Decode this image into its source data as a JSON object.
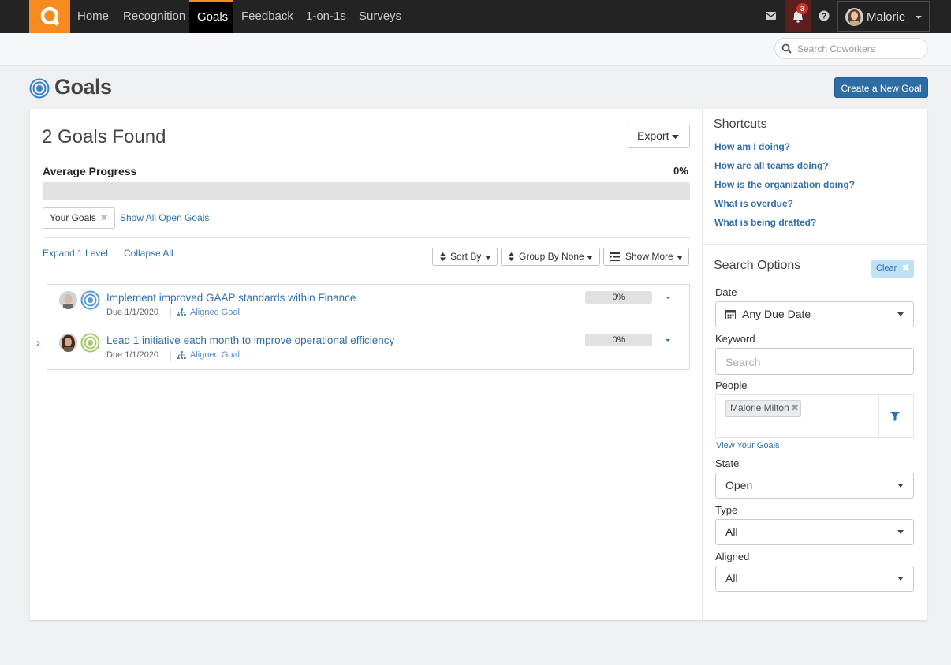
{
  "nav": {
    "items": [
      {
        "label": "Home"
      },
      {
        "label": "Recognition"
      },
      {
        "label": "Goals",
        "active": true
      },
      {
        "label": "Feedback"
      },
      {
        "label": "1-on-1s"
      },
      {
        "label": "Surveys"
      }
    ],
    "notification_count": "3",
    "user_name": "Malorie",
    "icons": [
      "logo-icon",
      "mail-icon",
      "bell-icon",
      "help-icon",
      "avatar",
      "caret-down-icon"
    ]
  },
  "search": {
    "placeholder": "Search Coworkers"
  },
  "page": {
    "title": "Goals",
    "create_button": "Create a New Goal"
  },
  "main": {
    "goals_found": "2 Goals Found",
    "export_label": "Export",
    "avg_progress_label": "Average Progress",
    "avg_progress_value": "0%",
    "avg_progress_fraction": 0,
    "filter_chip": "Your Goals",
    "filter_chip_remove": "✖",
    "show_all_link": "Show All Open Goals",
    "expand_link": "Expand 1 Level",
    "collapse_link": "Collapse All",
    "sort_label": "Sort By",
    "group_label": "Group By None",
    "showmore_label": "Show More"
  },
  "goals": [
    {
      "title": "Implement improved GAAP standards within Finance",
      "due": "Due 1/1/2020",
      "aligned": "Aligned Goal",
      "progress_text": "0%",
      "progress_fraction": 0,
      "status_color": "#5b9bd5"
    },
    {
      "title": "Lead 1 initiative each month to improve operational efficiency",
      "due": "Due 1/1/2020",
      "aligned": "Aligned Goal",
      "progress_text": "0%",
      "progress_fraction": 0,
      "status_color": "#a6c865"
    }
  ],
  "expand_chevron": "›",
  "sidebar": {
    "shortcuts_title": "Shortcuts",
    "shortcuts": [
      {
        "label": "How am I doing?"
      },
      {
        "label": "How are all teams doing?"
      },
      {
        "label": "How is the organization doing?"
      },
      {
        "label": "What is overdue?"
      },
      {
        "label": "What is being drafted?"
      }
    ],
    "search_options_title": "Search Options",
    "clear_label": "Clear",
    "clear_remove": "✖",
    "date_label": "Date",
    "date_value": "Any Due Date",
    "keyword_label": "Keyword",
    "keyword_placeholder": "Search",
    "people_label": "People",
    "people_chip": "Malorie Milton",
    "people_chip_remove": "✖",
    "view_your_goals": "View Your Goals",
    "state_label": "State",
    "state_value": "Open",
    "type_label": "Type",
    "type_value": "All",
    "aligned_label": "Aligned",
    "aligned_value": "All"
  },
  "colors": {
    "brand_orange": "#f68b1f",
    "primary_blue": "#2e6da4",
    "link_blue": "#2f6fab",
    "nav_bg": "#232323"
  }
}
